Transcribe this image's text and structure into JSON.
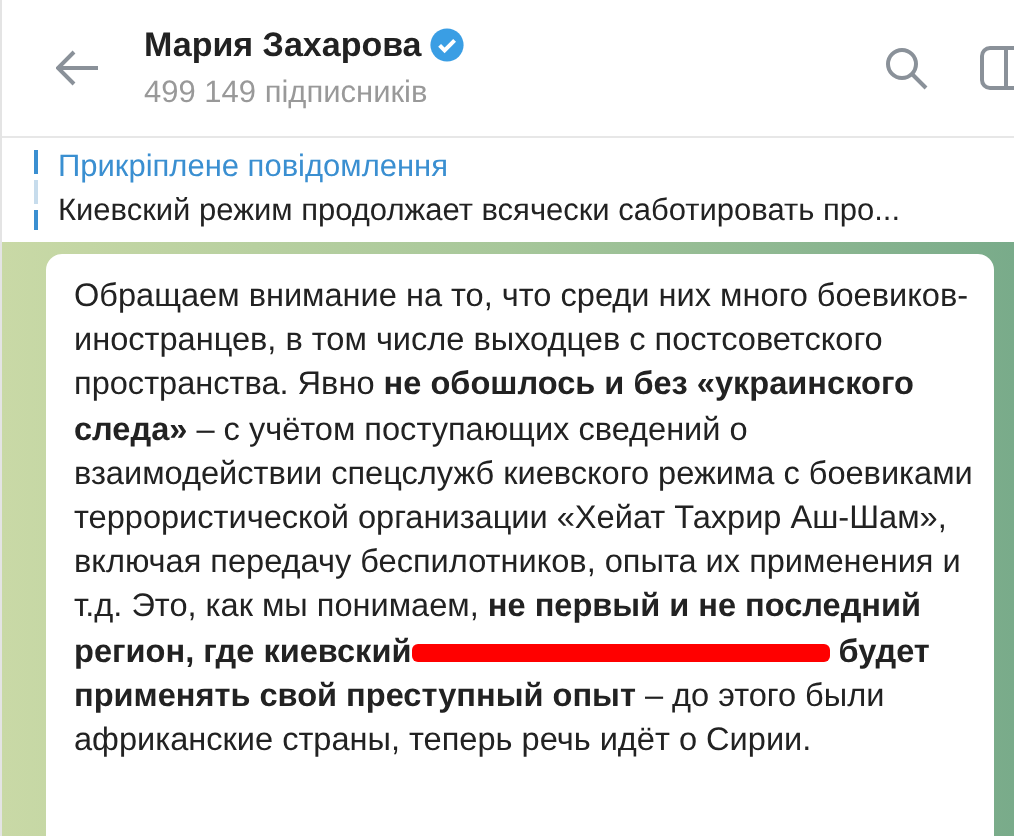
{
  "header": {
    "title": "Мария Захарова",
    "verified": true,
    "subtitle": "499 149 підписників"
  },
  "pinned": {
    "label": "Прикріплене повідомлення",
    "text": "Киевский режим продолжает всячески саботировать про..."
  },
  "message": {
    "text_before": "Обращаем внимание на то, что среди них много боевиков-иностранцев, в том числе выходцев с постсоветского пространства. Явно **не обошлось и без «украинского следа»** – с учётом поступающих сведений о взаимодействии спецслужб киевского режима с боевиками террористической организации «Хейат Тахрир Аш-Шам», включая передачу беспилотников, опыта их применения и т.д. Это, как мы понимаем, **не первый и не последний регион, где киевский**",
    "redacted": true,
    "text_after": " **будет применять свой преступный опыт** – до этого были африканские страны, теперь речь идёт о Сирии."
  }
}
